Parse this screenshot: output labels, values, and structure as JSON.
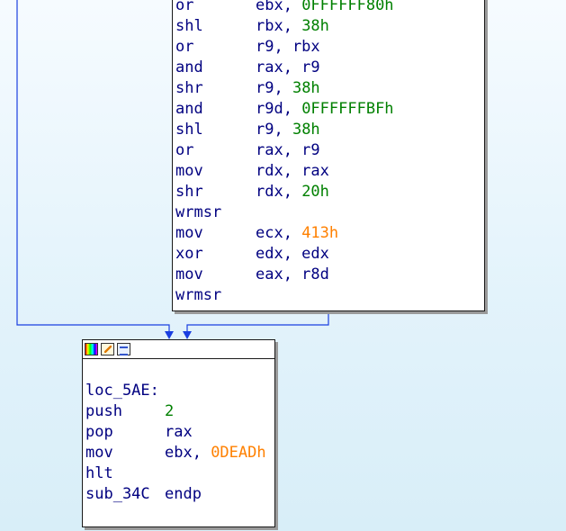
{
  "top_block": {
    "lines": [
      {
        "mnemonic": "or",
        "parts": [
          {
            "t": "ebx, "
          },
          {
            "t": "0FFFFFF80h",
            "c": "num"
          }
        ]
      },
      {
        "mnemonic": "shl",
        "parts": [
          {
            "t": "rbx, "
          },
          {
            "t": "38h",
            "c": "num"
          }
        ]
      },
      {
        "mnemonic": "or",
        "parts": [
          {
            "t": "r9, rbx"
          }
        ]
      },
      {
        "mnemonic": "and",
        "parts": [
          {
            "t": "rax, r9"
          }
        ]
      },
      {
        "mnemonic": "shr",
        "parts": [
          {
            "t": "r9, "
          },
          {
            "t": "38h",
            "c": "num"
          }
        ]
      },
      {
        "mnemonic": "and",
        "parts": [
          {
            "t": "r9d, "
          },
          {
            "t": "0FFFFFFBFh",
            "c": "num"
          }
        ]
      },
      {
        "mnemonic": "shl",
        "parts": [
          {
            "t": "r9, "
          },
          {
            "t": "38h",
            "c": "num"
          }
        ]
      },
      {
        "mnemonic": "or",
        "parts": [
          {
            "t": "rax, r9"
          }
        ]
      },
      {
        "mnemonic": "mov",
        "parts": [
          {
            "t": "rdx, rax"
          }
        ]
      },
      {
        "mnemonic": "shr",
        "parts": [
          {
            "t": "rdx, "
          },
          {
            "t": "20h",
            "c": "num"
          }
        ]
      },
      {
        "mnemonic": "wrmsr",
        "parts": []
      },
      {
        "mnemonic": "mov",
        "parts": [
          {
            "t": "ecx, "
          },
          {
            "t": "413h",
            "c": "const"
          }
        ]
      },
      {
        "mnemonic": "xor",
        "parts": [
          {
            "t": "edx, edx"
          }
        ]
      },
      {
        "mnemonic": "mov",
        "parts": [
          {
            "t": "eax, r8d"
          }
        ]
      },
      {
        "mnemonic": "wrmsr",
        "parts": []
      }
    ]
  },
  "bottom_block": {
    "header_icons": [
      "color-palette-icon",
      "rename-icon",
      "graph-overview-icon"
    ],
    "lines": [
      {
        "label": "loc_5AE:"
      },
      {
        "mnemonic": "push",
        "parts": [
          {
            "t": "2",
            "c": "num"
          }
        ]
      },
      {
        "mnemonic": "pop",
        "parts": [
          {
            "t": "rax"
          }
        ]
      },
      {
        "mnemonic": "mov",
        "parts": [
          {
            "t": "ebx, "
          },
          {
            "t": "0DEADh",
            "c": "const"
          }
        ]
      },
      {
        "mnemonic": "hlt",
        "parts": []
      },
      {
        "mnemonic": "sub_34C",
        "parts": [
          {
            "t": "endp"
          }
        ]
      }
    ]
  },
  "colors": {
    "edge": "#1a3fe0",
    "operand": "#000080",
    "number": "#008000",
    "constant": "#ff8000",
    "background_top": "#f6fbff",
    "background_bottom": "#d8eef8"
  }
}
